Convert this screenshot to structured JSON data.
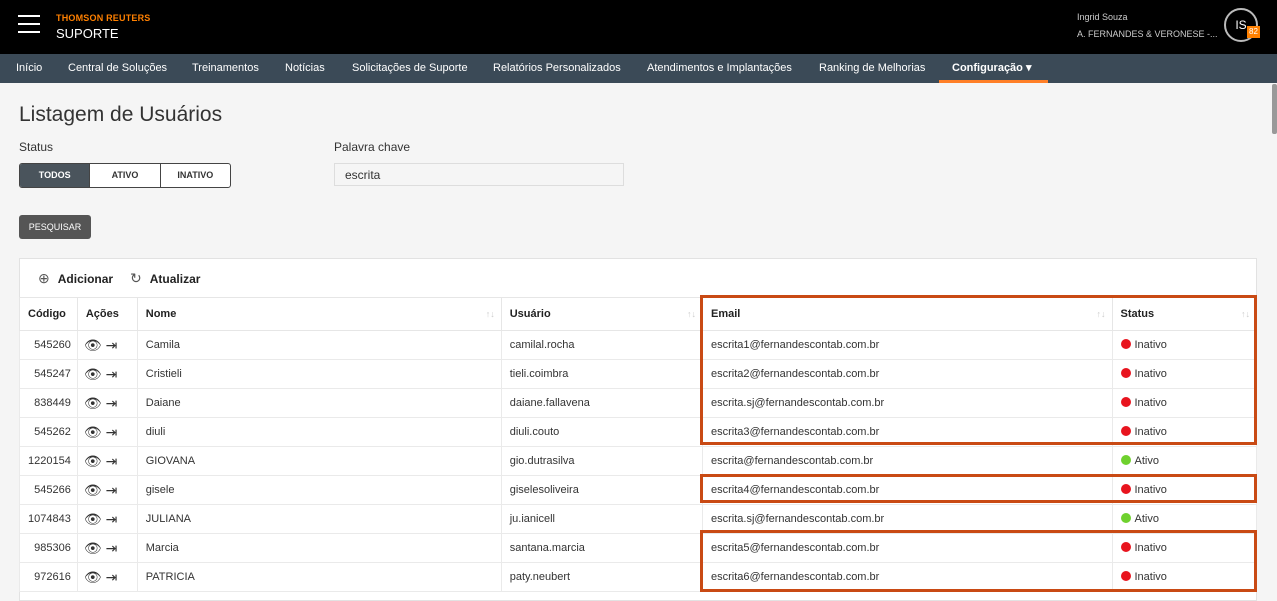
{
  "header": {
    "brand_top": "THOMSON REUTERS",
    "brand_sub": "SUPORTE",
    "user_name": "Ingrid Souza",
    "user_company": "A. FERNANDES & VERONESE -...",
    "avatar_initials": "IS",
    "avatar_badge": "82"
  },
  "nav": [
    "Início",
    "Central de Soluções",
    "Treinamentos",
    "Notícias",
    "Solicitações de Suporte",
    "Relatórios Personalizados",
    "Atendimentos e Implantações",
    "Ranking de Melhorias",
    "Configuração ▾"
  ],
  "page": {
    "title": "Listagem de Usuários",
    "status_label": "Status",
    "status_options": [
      "TODOS",
      "ATIVO",
      "INATIVO"
    ],
    "keyword_label": "Palavra chave",
    "keyword_value": "escrita",
    "search_label": "PESQUISAR",
    "add_label": "Adicionar",
    "refresh_label": "Atualizar"
  },
  "table": {
    "headers": [
      "Código",
      "Ações",
      "Nome",
      "Usuário",
      "Email",
      "Status"
    ],
    "rows": [
      {
        "code": "545260",
        "name": "Camila",
        "user": "camilal.rocha",
        "email": "escrita1@fernandescontab.com.br",
        "status": "Inativo"
      },
      {
        "code": "545247",
        "name": "Cristieli",
        "user": "tieli.coimbra",
        "email": "escrita2@fernandescontab.com.br",
        "status": "Inativo"
      },
      {
        "code": "838449",
        "name": "Daiane",
        "user": "daiane.fallavena",
        "email": "escrita.sj@fernandescontab.com.br",
        "status": "Inativo"
      },
      {
        "code": "545262",
        "name": "diuli",
        "user": "diuli.couto",
        "email": "escrita3@fernandescontab.com.br",
        "status": "Inativo"
      },
      {
        "code": "1220154",
        "name": "GIOVANA",
        "user": "gio.dutrasilva",
        "email": "escrita@fernandescontab.com.br",
        "status": "Ativo"
      },
      {
        "code": "545266",
        "name": "gisele",
        "user": "giselesoliveira",
        "email": "escrita4@fernandescontab.com.br",
        "status": "Inativo"
      },
      {
        "code": "1074843",
        "name": "JULIANA",
        "user": "ju.ianicell",
        "email": "escrita.sj@fernandescontab.com.br",
        "status": "Ativo"
      },
      {
        "code": "985306",
        "name": "Marcia",
        "user": "santana.marcia",
        "email": "escrita5@fernandescontab.com.br",
        "status": "Inativo"
      },
      {
        "code": "972616",
        "name": "PATRICIA",
        "user": "paty.neubert",
        "email": "escrita6@fernandescontab.com.br",
        "status": "Inativo"
      }
    ]
  },
  "colors": {
    "inactive": "#e8141e",
    "active": "#6fd12e",
    "highlight": "#c94a14",
    "accent": "#ff7f27"
  },
  "icons": [
    "menu-icon",
    "add-circle-icon",
    "refresh-icon",
    "eye-icon",
    "logout-icon",
    "sort-icon"
  ]
}
